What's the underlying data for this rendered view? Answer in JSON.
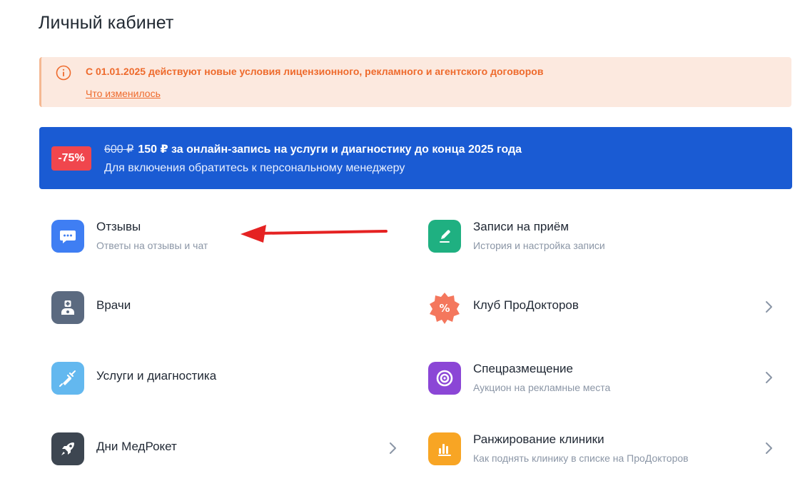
{
  "page": {
    "title": "Личный кабинет"
  },
  "notice": {
    "text": "С 01.01.2025 действуют новые условия лицензионного, рекламного и агентского договоров",
    "link": "Что изменилось",
    "icon": "info-icon",
    "color": "#ee6a2c"
  },
  "promo": {
    "badge": "-75%",
    "old_price": "600 ₽",
    "headline": "150 ₽ за онлайн-запись на услуги и диагностику до конца 2025 года",
    "subline": "Для включения обратитесь к персональному менеджеру",
    "color": "#1a5bd3"
  },
  "menu": [
    {
      "title": "Отзывы",
      "subtitle": "Ответы на отзывы и чат",
      "icon": "chat-bubble-icon",
      "icon_bg": "#3f7ef3"
    },
    {
      "title": "Записи на приём",
      "subtitle": "История и настройка записи",
      "icon": "edit-pen-icon",
      "icon_bg": "#1fb081"
    },
    {
      "title": "Врачи",
      "subtitle": "",
      "icon": "doctor-icon",
      "icon_bg": "#5b6a80"
    },
    {
      "title": "Клуб ПроДокторов",
      "subtitle": "",
      "icon": "percent-badge-icon",
      "icon_bg": "#f4775d"
    },
    {
      "title": "Услуги и диагностика",
      "subtitle": "",
      "icon": "syringe-icon",
      "icon_bg": "#63b8ef"
    },
    {
      "title": "Спецразмещение",
      "subtitle": "Аукцион на рекламные места",
      "icon": "target-icon",
      "icon_bg": "#8b46d6"
    },
    {
      "title": "Дни МедРокет",
      "subtitle": "",
      "icon": "rocket-icon",
      "icon_bg": "#3d4651"
    },
    {
      "title": "Ранжирование клиники",
      "subtitle": "Как поднять клинику в списке на ПроДокторов",
      "icon": "bar-chart-icon",
      "icon_bg": "#f8a524"
    }
  ],
  "annotation": {
    "color": "#e52222"
  }
}
